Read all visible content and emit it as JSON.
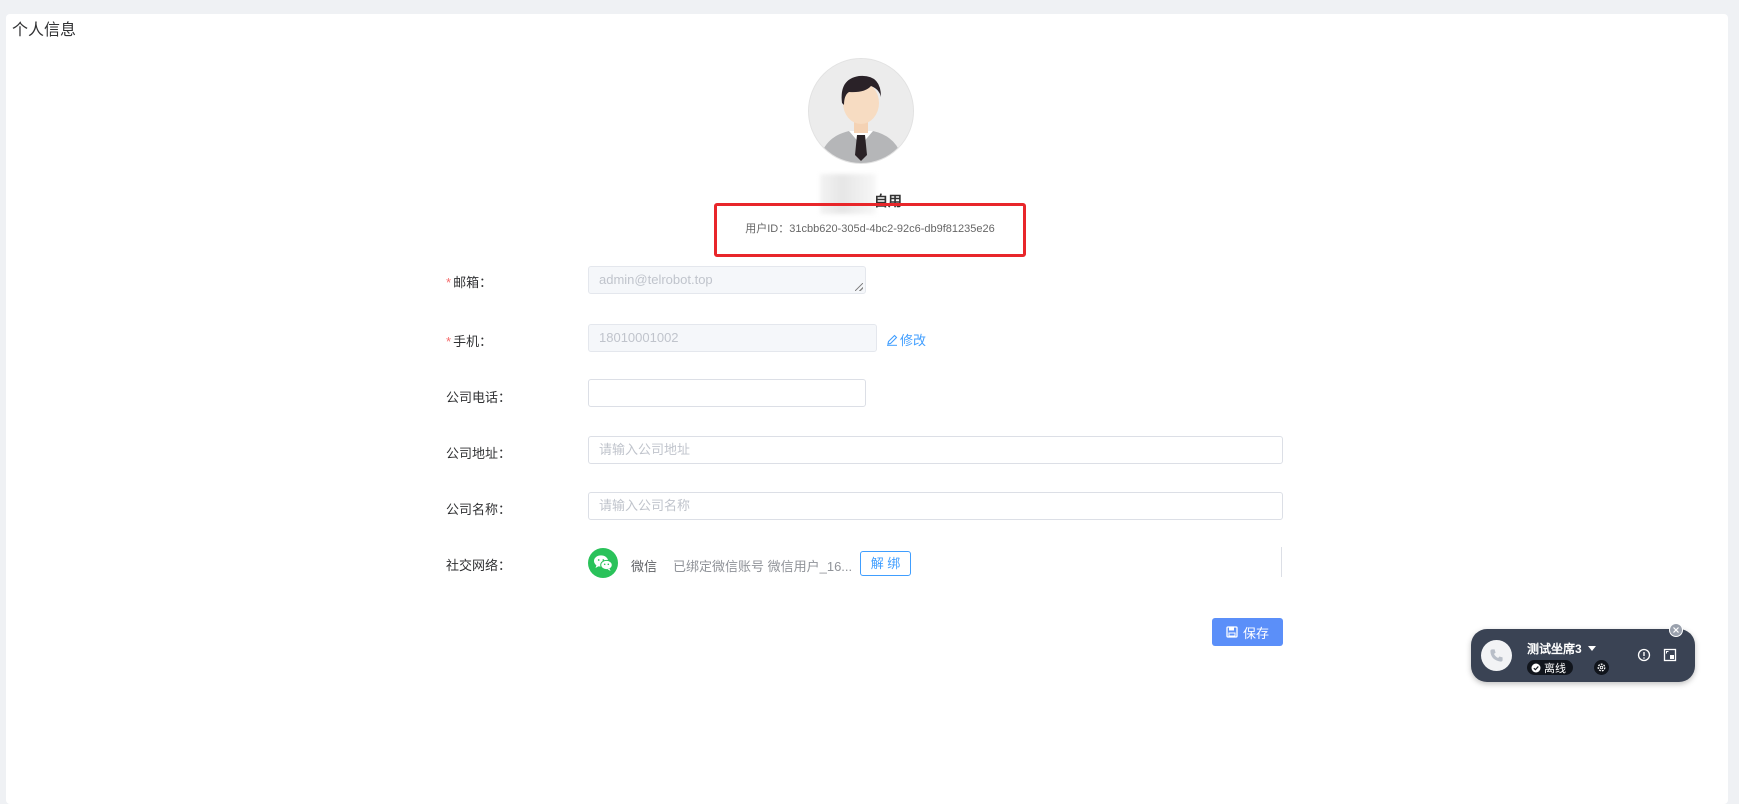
{
  "page": {
    "title": "个人信息"
  },
  "profile": {
    "name_suffix": "自用",
    "user_id_label": "用户ID：",
    "user_id": "31cbb620-305d-4bc2-92c6-db9f81235e26"
  },
  "form": {
    "email": {
      "label": "邮箱：",
      "required": true,
      "value": "admin@telrobot.top"
    },
    "mobile": {
      "label": "手机：",
      "required": true,
      "value": "18010001002",
      "edit_label": "修改"
    },
    "company_phone": {
      "label": "公司电话：",
      "value": ""
    },
    "company_address": {
      "label": "公司地址：",
      "placeholder": "请输入公司地址"
    },
    "company_name": {
      "label": "公司名称：",
      "placeholder": "请输入公司名称"
    },
    "social": {
      "label": "社交网络：",
      "platform": "微信",
      "status": "已绑定微信账号 微信用户_16...",
      "unbind_label": "解 绑"
    },
    "save_label": "保存"
  },
  "call_widget": {
    "agent_name": "测试坐席3",
    "status": "离线"
  },
  "colors": {
    "accent": "#409eff",
    "save_button": "#5b8ff9",
    "wechat": "#2ac25a",
    "highlight_box": "#e8262a",
    "widget_bg": "#3a4354"
  },
  "icons": {
    "avatar": "user-avatar-illustration",
    "edit": "pencil-icon",
    "wechat": "wechat-icon",
    "save": "floppy-disk-icon",
    "phone": "phone-icon",
    "dropdown": "caret-down-icon",
    "status": "check-circle-icon",
    "settings": "gear-icon",
    "info": "info-icon",
    "expand": "window-expand-icon",
    "close": "close-icon"
  }
}
